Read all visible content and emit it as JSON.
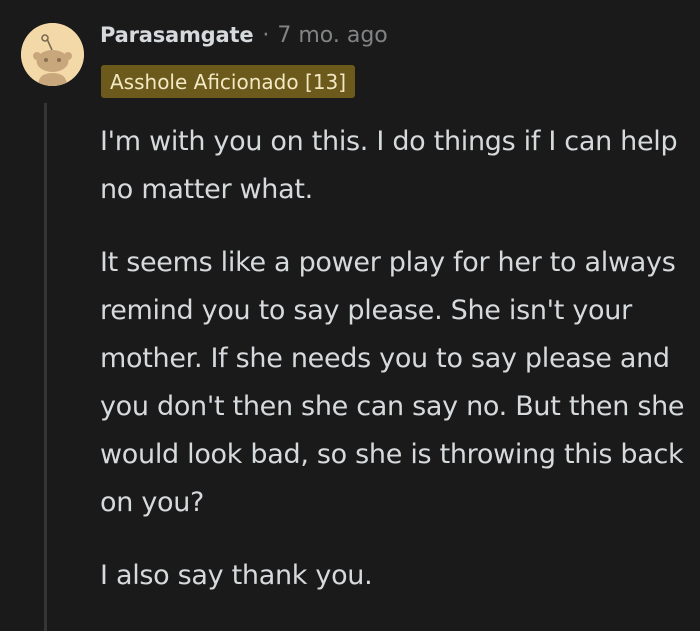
{
  "comment": {
    "author": "Parasamgate",
    "separator": "·",
    "timestamp": "7 mo. ago",
    "flair": "Asshole Aficionado [13]",
    "paragraphs": [
      "I'm with you on this. I do things if I can help no matter what.",
      "It seems like a power play for her to always remind you to say please. She isn't your mother. If she needs you to say please and you don't then she can say no. But then she would look bad, so she is throwing this back on you?",
      "I also say thank you."
    ]
  },
  "icons": {
    "avatar": "snoo-avatar-icon"
  },
  "colors": {
    "background": "#1a1a1b",
    "text": "#d7dadc",
    "meta": "#818384",
    "flair_bg": "#6b5a1b",
    "flair_text": "#f3e8c4",
    "thread_line": "#343536",
    "avatar_bg": "#f4d9a8"
  }
}
